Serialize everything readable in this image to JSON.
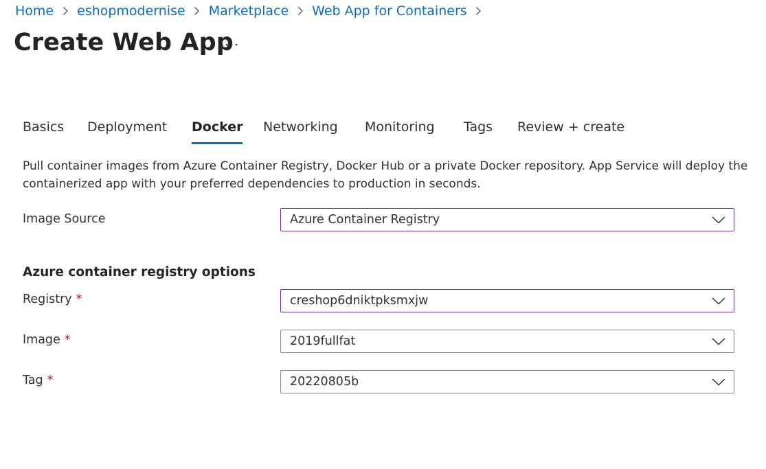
{
  "breadcrumb": {
    "items": [
      "Home",
      "eshopmodernise",
      "Marketplace",
      "Web App for Containers"
    ]
  },
  "page": {
    "title": "Create Web App",
    "more_label": "···"
  },
  "tabs": [
    {
      "label": "Basics",
      "active": false
    },
    {
      "label": "Deployment",
      "active": false
    },
    {
      "label": "Docker",
      "active": true
    },
    {
      "label": "Networking",
      "active": false
    },
    {
      "label": "Monitoring",
      "active": false
    },
    {
      "label": "Tags",
      "active": false
    },
    {
      "label": "Review + create",
      "active": false
    }
  ],
  "description": "Pull container images from Azure Container Registry, Docker Hub or a private Docker repository. App Service will deploy the containerized app with your preferred dependencies to production in seconds.",
  "form": {
    "image_source": {
      "label": "Image Source",
      "value": "Azure Container Registry"
    },
    "registry_section_title": "Azure container registry options",
    "registry": {
      "label": "Registry",
      "required_mark": "*",
      "value": "creshop6dniktpksmxjw"
    },
    "image": {
      "label": "Image",
      "required_mark": "*",
      "value": "2019fullfat"
    },
    "tag": {
      "label": "Tag",
      "required_mark": "*",
      "value": "20220805b"
    }
  },
  "colors": {
    "link": "#0f6cbd",
    "accent": "#0f6cbd",
    "focus_border": "#6b2e8c",
    "required": "#a4262c"
  }
}
